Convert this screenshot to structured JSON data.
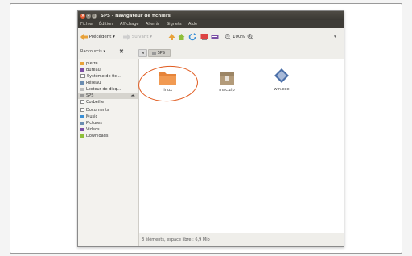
{
  "window": {
    "title": "SPS - Navigateur de fichiers",
    "controls": [
      "×",
      "–",
      "□"
    ]
  },
  "menu": [
    "Fichier",
    "Édition",
    "Affichage",
    "Aller à",
    "Signets",
    "Aide"
  ],
  "toolbar": {
    "back": "Précédent",
    "forward": "Suivant",
    "zoom": "100%"
  },
  "location": {
    "places_label": "Raccourcis",
    "path_segment": "SPS"
  },
  "sidebar": {
    "items": [
      "pierre",
      "Bureau",
      "Système de fic...",
      "Réseau",
      "Lecteur de disq...",
      "SPS",
      "Corbeille",
      "Documents",
      "Music",
      "Pictures",
      "Videos",
      "Downloads"
    ]
  },
  "files": [
    {
      "name": "linux",
      "icon": "folder-icon"
    },
    {
      "name": "mac.zip",
      "icon": "archive-icon"
    },
    {
      "name": "win.exe",
      "icon": "executable-icon"
    }
  ],
  "status": "3 éléments, espace libre : 6,9 Mio",
  "colors": {
    "accent": "#e05a1e",
    "titlebar": "#3a3833"
  }
}
